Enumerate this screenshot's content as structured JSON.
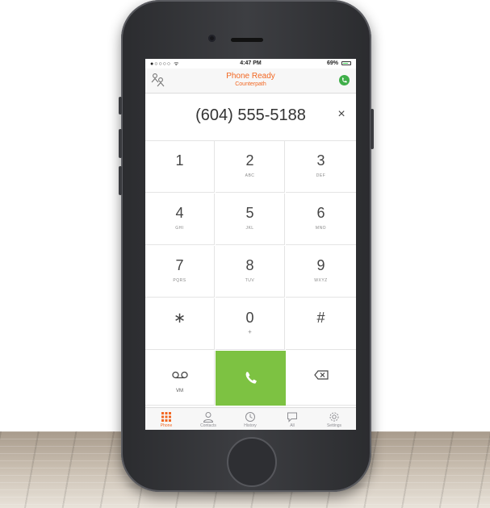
{
  "status_bar": {
    "carrier": "●○○○○ ᯤ",
    "time": "4:47 PM",
    "battery": "69%",
    "battery_level": 0.69
  },
  "header": {
    "title": "Phone Ready",
    "subtitle": "Counterpath",
    "accounts_icon": "accounts-icon",
    "presence_icon": "presence-icon"
  },
  "dialer": {
    "number": "(604) 555-5188",
    "clear_symbol": "×"
  },
  "keypad": {
    "keys": [
      {
        "digit": "1",
        "letters": ""
      },
      {
        "digit": "2",
        "letters": "ABC"
      },
      {
        "digit": "3",
        "letters": "DEF"
      },
      {
        "digit": "4",
        "letters": "GHI"
      },
      {
        "digit": "5",
        "letters": "JKL"
      },
      {
        "digit": "6",
        "letters": "MNO"
      },
      {
        "digit": "7",
        "letters": "PQRS"
      },
      {
        "digit": "8",
        "letters": "TUV"
      },
      {
        "digit": "9",
        "letters": "WXYZ"
      },
      {
        "digit": "∗",
        "letters": ""
      },
      {
        "digit": "0",
        "letters": "+"
      },
      {
        "digit": "#",
        "letters": ""
      }
    ],
    "voicemail_label": "VM",
    "call_color": "#7dc242"
  },
  "tabs": [
    {
      "label": "Phone",
      "icon": "keypad-icon",
      "active": true
    },
    {
      "label": "Contacts",
      "icon": "contacts-icon",
      "active": false
    },
    {
      "label": "History",
      "icon": "clock-icon",
      "active": false
    },
    {
      "label": "All",
      "icon": "chat-icon",
      "active": false
    },
    {
      "label": "Settings",
      "icon": "gear-icon",
      "active": false
    }
  ],
  "colors": {
    "accent": "#f26722",
    "call_green": "#7dc242",
    "presence_green": "#3fae49"
  }
}
